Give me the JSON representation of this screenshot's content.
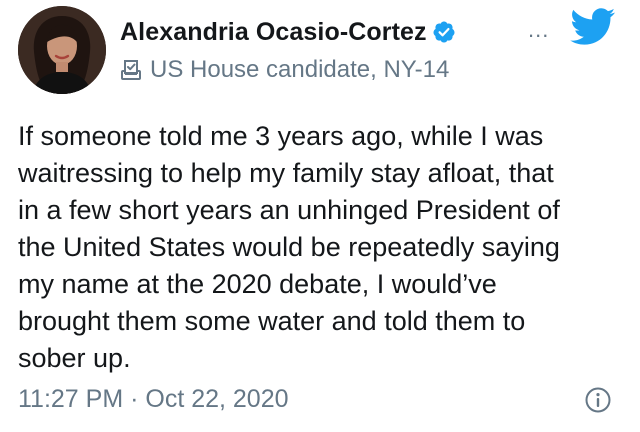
{
  "tweet": {
    "author": {
      "display_name": "Alexandria Ocasio-Cortez",
      "label": "US House candidate, NY-14"
    },
    "more_glyph": "...",
    "text": "If someone told me 3 years ago, while I was\nwaitressing to help my family stay afloat, that\nin a few short years an unhinged President of\nthe United States would be repeatedly saying\nmy name at the 2020 debate, I would’ve\nbrought them some water and told them to\nsober up.",
    "timestamp": "11:27 PM · Oct 22, 2020"
  },
  "icons": {
    "verified": "verified-badge-icon",
    "ballot": "ballot-box-icon",
    "brand": "twitter-bird-icon",
    "info": "info-icon"
  },
  "colors": {
    "brand_blue": "#1da1f2",
    "text_primary": "#14171a",
    "text_secondary": "#657786"
  }
}
